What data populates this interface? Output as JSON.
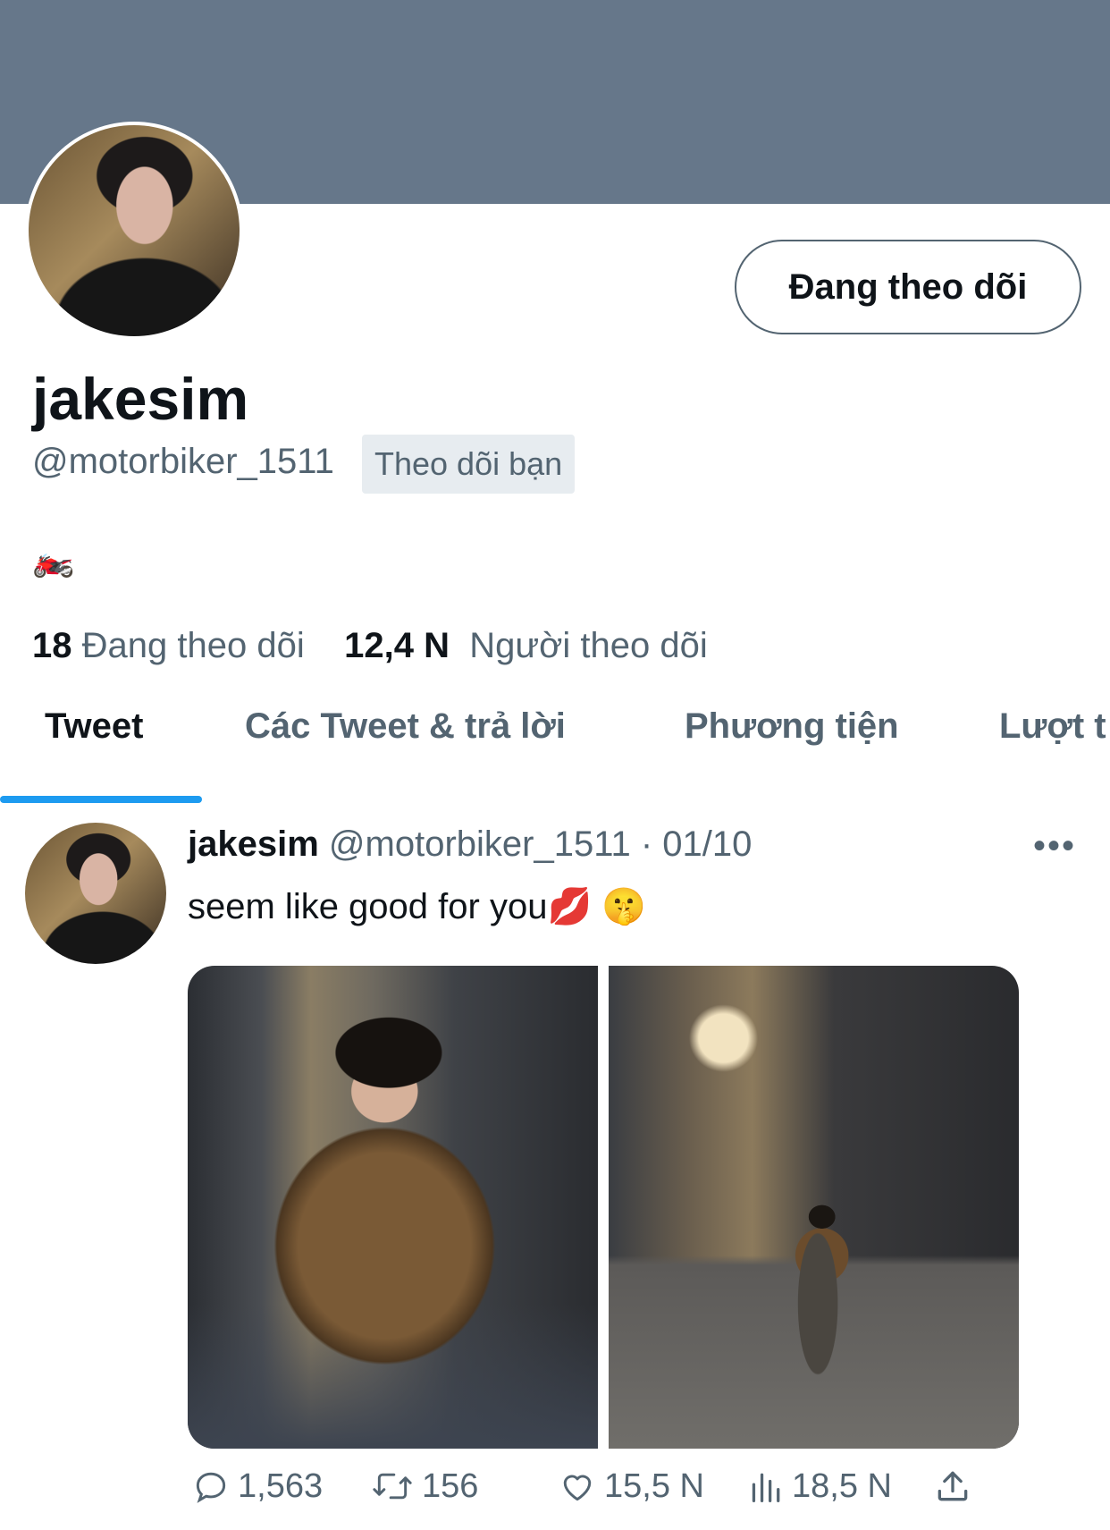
{
  "profile": {
    "display_name": "jakesim",
    "handle": "@motorbiker_1511",
    "follows_you_badge": "Theo dõi bạn",
    "bio": "🏍️",
    "follow_button_label": "Đang theo dõi",
    "stats": {
      "following_count": "18",
      "following_label": "Đang theo dõi",
      "followers_count": "12,4 N",
      "followers_label": "Người theo dõi"
    }
  },
  "tabs": [
    {
      "label": "Tweet",
      "active": true
    },
    {
      "label": "Các Tweet & trả lời",
      "active": false
    },
    {
      "label": "Phương tiện",
      "active": false
    },
    {
      "label": "Lượt t",
      "active": false
    }
  ],
  "tweet": {
    "author_name": "jakesim",
    "author_handle": "@motorbiker_1511",
    "separator": "·",
    "date": "01/10",
    "text": "seem like good for you💋 🤫",
    "actions": {
      "replies": "1,563",
      "retweets": "156",
      "likes": "15,5 N",
      "views": "18,5 N"
    }
  },
  "colors": {
    "banner": "#66778a",
    "accent": "#1d9bf0",
    "secondary_text": "#536471",
    "badge_bg": "#e7ecf0"
  },
  "icons": [
    "reply-icon",
    "retweet-icon",
    "like-icon",
    "views-icon",
    "share-icon",
    "more-icon"
  ]
}
